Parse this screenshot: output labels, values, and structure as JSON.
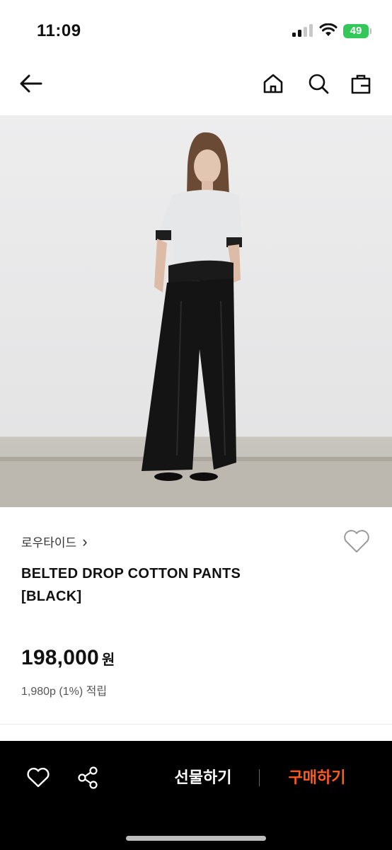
{
  "status_bar": {
    "time": "11:09",
    "battery": "49"
  },
  "nav": {
    "back_icon": "arrow-left-icon",
    "home_icon": "home-icon",
    "search_icon": "search-icon",
    "cart_icon": "shopping-bag-icon"
  },
  "product": {
    "image_alt": "model wearing black wide-leg pants and grey t-shirt",
    "brand": "로우타이드",
    "brand_chevron": "›",
    "name": "BELTED DROP COTTON PANTS [BLACK]",
    "price": "198,000",
    "currency": "원",
    "points": "1,980p (1%) 적립"
  },
  "bottom_bar": {
    "wishlist_icon": "heart-icon",
    "share_icon": "share-icon",
    "gift_label": "선물하기",
    "buy_label": "구매하기"
  },
  "colors": {
    "accent": "#ff5a1f",
    "bar": "#000000",
    "battery": "#34c759"
  }
}
